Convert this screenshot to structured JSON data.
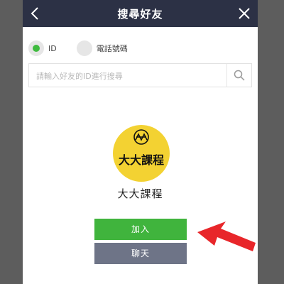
{
  "header": {
    "title": "搜尋好友"
  },
  "search_type": {
    "options": [
      {
        "label": "ID",
        "selected": true
      },
      {
        "label": "電話號碼",
        "selected": false
      }
    ]
  },
  "search": {
    "placeholder": "請輸入好友的ID進行搜尋",
    "value": ""
  },
  "profile": {
    "name": "大大課程",
    "avatar_text": "大大課程"
  },
  "actions": {
    "add_label": "加入",
    "chat_label": "聊天"
  },
  "colors": {
    "header_bg": "#2c3145",
    "accent_green": "#40b43d",
    "chat_button": "#6e7487",
    "avatar_bg": "#f3d232",
    "arrow_red": "#e8262a"
  }
}
